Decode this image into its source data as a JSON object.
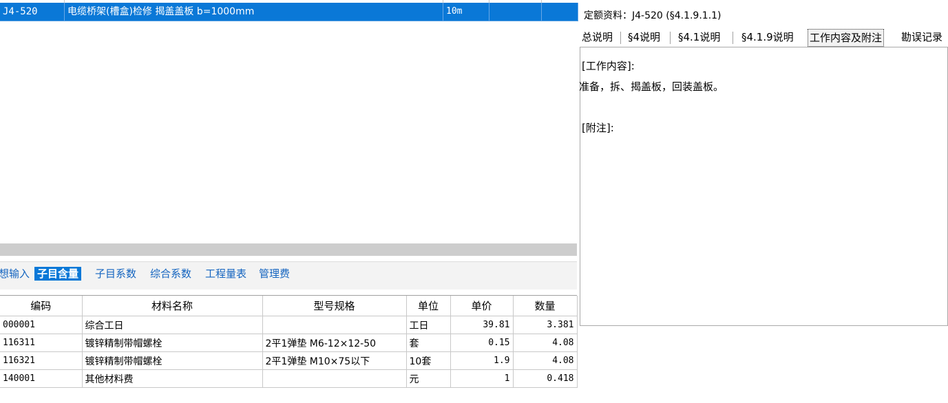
{
  "selected_item": {
    "code": "J4-520",
    "name": "电缆桥架(槽盒)检修 揭盖盖板 b=1000mm",
    "unit": "10m"
  },
  "bottom_tabs": [
    {
      "label": "想输入",
      "active": false
    },
    {
      "label": "子目含量",
      "active": true
    },
    {
      "label": "子目系数",
      "active": false
    },
    {
      "label": "综合系数",
      "active": false
    },
    {
      "label": "工程量表",
      "active": false
    },
    {
      "label": "管理费",
      "active": false
    }
  ],
  "materials": {
    "columns": [
      "编码",
      "材料名称",
      "型号规格",
      "单位",
      "单价",
      "数量"
    ],
    "rows": [
      {
        "code": "000001",
        "name": "综合工日",
        "spec": "",
        "unit": "工日",
        "price": "39.81",
        "qty": "3.381"
      },
      {
        "code": "116311",
        "name": "镀锌精制带帽螺栓",
        "spec": "2平1弹垫 M6-12×12-50",
        "unit": "套",
        "price": "0.15",
        "qty": "4.08"
      },
      {
        "code": "116321",
        "name": "镀锌精制带帽螺栓",
        "spec": "2平1弹垫 M10×75以下",
        "unit": "10套",
        "price": "1.9",
        "qty": "4.08"
      },
      {
        "code": "140001",
        "name": "其他材料费",
        "spec": "",
        "unit": "元",
        "price": "1",
        "qty": "0.418"
      }
    ]
  },
  "quota_panel": {
    "title": "定额资料：J4-520 (§4.1.9.1.1)",
    "tabs": [
      {
        "label": "总说明",
        "active": false
      },
      {
        "label": "§4说明",
        "active": false
      },
      {
        "label": "§4.1说明",
        "active": false
      },
      {
        "label": "§4.1.9说明",
        "active": false
      },
      {
        "label": "工作内容及附注",
        "active": true
      },
      {
        "label": "勘误记录",
        "active": false
      }
    ],
    "work_content_heading": "[工作内容]:",
    "work_content": "准备，拆、揭盖板，回装盖板。",
    "notes_heading": "[附注]:"
  },
  "colors": {
    "selection": "#0a78d7",
    "tab_link": "#1565c0",
    "scrollbar": "#cdcdcd"
  }
}
